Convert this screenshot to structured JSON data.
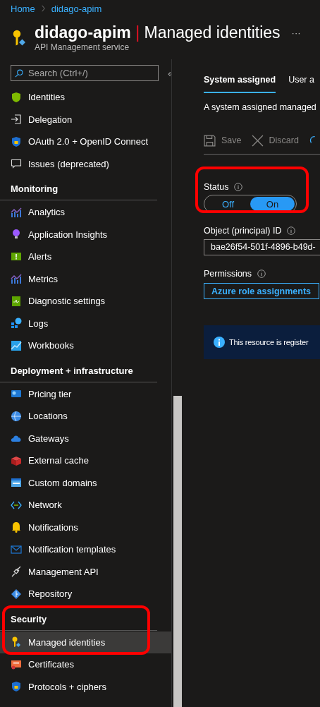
{
  "breadcrumb": [
    {
      "label": "Home"
    },
    {
      "label": "didago-apim"
    }
  ],
  "header": {
    "resource": "didago-apim",
    "separator": "|",
    "page": "Managed identities",
    "subtitle": "API Management service",
    "more": "···"
  },
  "sidebar": {
    "search": {
      "placeholder": "Search (Ctrl+/)"
    },
    "collapse": "«",
    "sections": [
      {
        "items": [
          {
            "label": "Identities",
            "selected": false
          },
          {
            "label": "Delegation",
            "selected": false
          },
          {
            "label": "OAuth 2.0 + OpenID Connect",
            "selected": false
          },
          {
            "label": "Issues (deprecated)",
            "selected": false
          }
        ]
      },
      {
        "heading": "Monitoring",
        "items": [
          {
            "label": "Analytics",
            "selected": false
          },
          {
            "label": "Application Insights",
            "selected": false
          },
          {
            "label": "Alerts",
            "selected": false
          },
          {
            "label": "Metrics",
            "selected": false
          },
          {
            "label": "Diagnostic settings",
            "selected": false
          },
          {
            "label": "Logs",
            "selected": false
          },
          {
            "label": "Workbooks",
            "selected": false
          }
        ]
      },
      {
        "heading": "Deployment + infrastructure",
        "items": [
          {
            "label": "Pricing tier",
            "selected": false
          },
          {
            "label": "Locations",
            "selected": false
          },
          {
            "label": "Gateways",
            "selected": false
          },
          {
            "label": "External cache",
            "selected": false
          },
          {
            "label": "Custom domains",
            "selected": false
          },
          {
            "label": "Network",
            "selected": false
          },
          {
            "label": "Notifications",
            "selected": false
          },
          {
            "label": "Notification templates",
            "selected": false
          },
          {
            "label": "Management API",
            "selected": false
          },
          {
            "label": "Repository",
            "selected": false
          }
        ]
      },
      {
        "heading": "Security",
        "highlighted": true,
        "items": [
          {
            "label": "Managed identities",
            "selected": true
          },
          {
            "label": "Certificates",
            "selected": false
          },
          {
            "label": "Protocols + ciphers",
            "selected": false
          }
        ]
      }
    ]
  },
  "tabs": [
    {
      "label": "System assigned",
      "selected": true
    },
    {
      "label": "User a",
      "selected": false
    }
  ],
  "description": "A system assigned managed",
  "toolbar": [
    {
      "label": "Save",
      "disabled": true
    },
    {
      "label": "Discard",
      "disabled": true
    }
  ],
  "status": {
    "label": "Status",
    "highlighted": true,
    "options": [
      {
        "label": "Off",
        "selected": false
      },
      {
        "label": "On",
        "selected": true
      }
    ]
  },
  "object_id": {
    "label": "Object (principal) ID",
    "value": "bae26f54-501f-4896-b49d-"
  },
  "permissions": {
    "label": "Permissions",
    "button": "Azure role assignments"
  },
  "banner": {
    "text": "This resource is register"
  }
}
